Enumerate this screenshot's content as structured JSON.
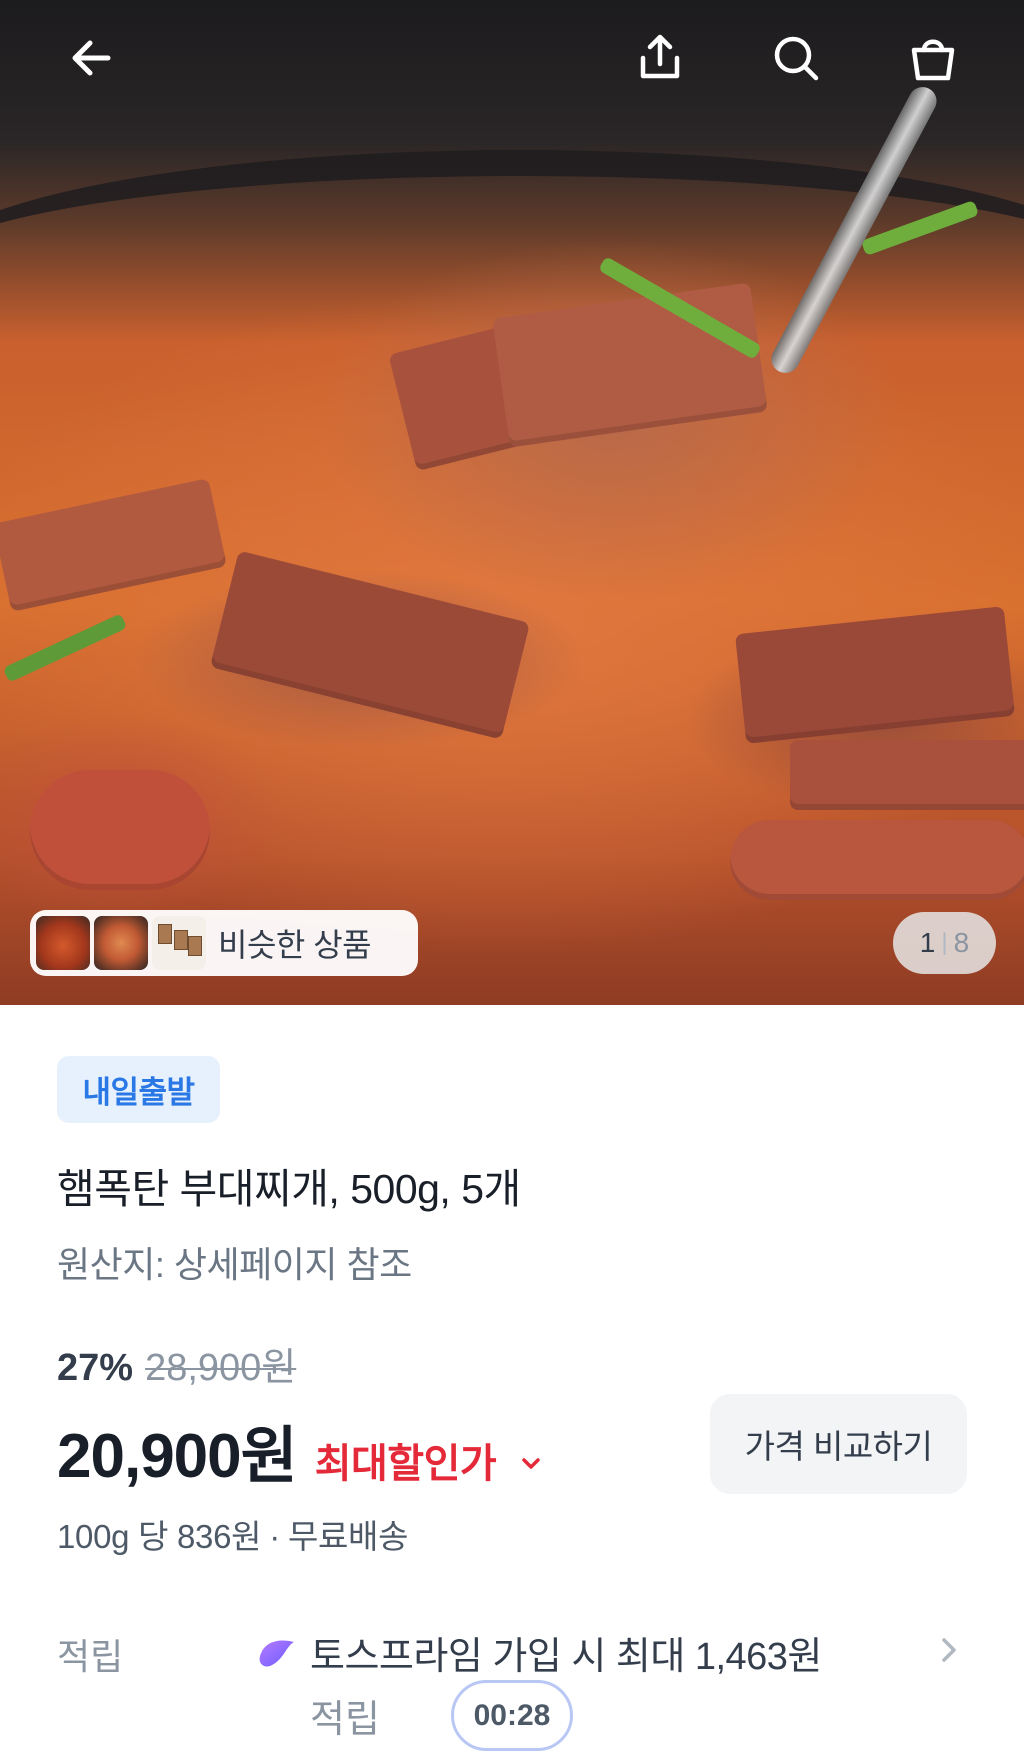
{
  "topbar": {
    "icons": [
      "back-arrow-icon",
      "share-icon",
      "search-icon",
      "shopping-bag-icon"
    ]
  },
  "gallery": {
    "similar_label": "비슷한 상품",
    "current_page": "1",
    "total_pages": "8",
    "separator": "|"
  },
  "product": {
    "badge": "내일출발",
    "title": "햄폭탄 부대찌개, 500g, 5개",
    "origin": "원산지: 상세페이지 참조",
    "discount_percent": "27%",
    "original_price": "28,900원",
    "sale_price": "20,900원",
    "max_discount_label": "최대할인가",
    "compare_button": "가격 비교하기",
    "unit_price": "100g 당 836원",
    "dot": "·",
    "shipping": "무료배송"
  },
  "reward": {
    "label": "적립",
    "line1": "토스프라임 가입 시 최대 1,463원",
    "line2": "적립",
    "timer": "00:28"
  },
  "colors": {
    "badge_bg": "#e7f1fd",
    "badge_text": "#2a77e6",
    "discount_red": "#e42939",
    "primary_text": "#191f28",
    "secondary_text": "#6b7684"
  }
}
